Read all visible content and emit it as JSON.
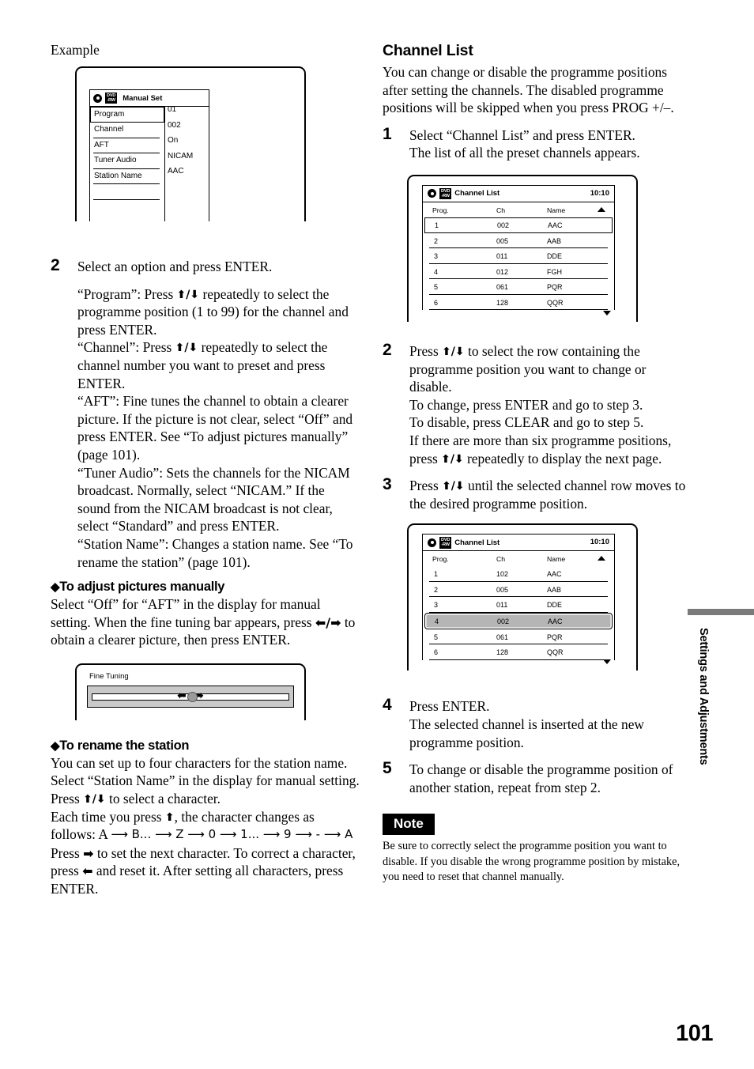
{
  "page": {
    "number": "101",
    "side_tab": "Settings and Adjustments"
  },
  "left_column": {
    "example_label": "Example",
    "manual_set_screen": {
      "icon_disc": "disc-icon",
      "icon_dvd_line1": "DVD",
      "icon_dvd_line2": "-RW",
      "title": "Manual Set",
      "rows": [
        {
          "label": "Program",
          "value": "01"
        },
        {
          "label": "Channel",
          "value": "002"
        },
        {
          "label": "AFT",
          "value": "On"
        },
        {
          "label": "Tuner Audio",
          "value": "NICAM"
        },
        {
          "label": "Station Name",
          "value": "AAC"
        }
      ]
    },
    "step2": {
      "number": "2",
      "heading": "Select an option and press ENTER.",
      "p_program_a": "“Program”: Press ",
      "p_program_b": " repeatedly to select the programme position (1 to 99) for the channel and press ENTER.",
      "p_channel_a": "“Channel”: Press ",
      "p_channel_b": " repeatedly to select the channel number you want to preset and press ENTER.",
      "p_aft": "“AFT”: Fine tunes the channel to obtain a clearer picture. If the picture is not clear, select “Off” and press ENTER. See “To adjust pictures manually” (page 101).",
      "p_tuner": "“Tuner Audio”: Sets the channels for the NICAM broadcast. Normally, select “NICAM.” If the sound from the NICAM broadcast is not clear, select “Standard” and press ENTER.",
      "p_station": "“Station Name”: Changes a station name. See “To rename the station” (page 101)."
    },
    "adjust_section": {
      "heading": "To adjust pictures manually",
      "text_a": "Select “Off” for “AFT” in the display for manual setting. When the fine tuning bar appears, press ",
      "text_b": " to obtain a clearer picture, then press ENTER."
    },
    "fine_tuning_screen": {
      "label": "Fine Tuning"
    },
    "rename_section": {
      "heading": "To rename the station",
      "p1": "You can set up to four characters for the station name. Select “Station Name” in the display for manual setting.",
      "p2_a": "Press ",
      "p2_b": " to select a character.",
      "p3_a": "Each time you press ",
      "p3_b": ", the character changes as follows: A ",
      "p3_seq": "⟶ B... ⟶ Z ⟶ 0 ⟶ 1... ⟶ 9 ⟶ - ⟶ A",
      "p4_a": "Press ",
      "p4_b": " to set the next character. To correct a character, press ",
      "p4_c": " and reset it. After setting all characters, press ENTER."
    }
  },
  "right_column": {
    "heading": "Channel List",
    "intro": "You can change or disable the programme positions after setting the channels. The disabled programme positions will be skipped when you press PROG +/–.",
    "step1": {
      "number": "1",
      "line1": "Select “Channel List” and press ENTER.",
      "line2": "The list of all the preset channels appears."
    },
    "channel_list_screen_1": {
      "icon_dvd_line1": "DVD",
      "icon_dvd_line2": "-RW",
      "title": "Channel List",
      "clock": "10:10",
      "columns": [
        "Prog.",
        "Ch",
        "Name"
      ],
      "rows": [
        {
          "prog": "1",
          "ch": "002",
          "name": "AAC",
          "state": "outline"
        },
        {
          "prog": "2",
          "ch": "005",
          "name": "AAB",
          "state": "normal"
        },
        {
          "prog": "3",
          "ch": "011",
          "name": "DDE",
          "state": "normal"
        },
        {
          "prog": "4",
          "ch": "012",
          "name": "FGH",
          "state": "normal"
        },
        {
          "prog": "5",
          "ch": "061",
          "name": "PQR",
          "state": "normal"
        },
        {
          "prog": "6",
          "ch": "128",
          "name": "QQR",
          "state": "normal"
        }
      ]
    },
    "step2": {
      "number": "2",
      "t_a": "Press ",
      "t_b": " to select the row containing the programme position you want to change or disable.",
      "t_c": "To change, press ENTER and go to step 3.",
      "t_d": "To disable, press CLEAR and go to step 5.",
      "t_e": "If there are more than six programme positions, press ",
      "t_f": " repeatedly to display the next page."
    },
    "step3": {
      "number": "3",
      "t_a": "Press ",
      "t_b": " until the selected channel row moves to the desired programme position."
    },
    "channel_list_screen_2": {
      "icon_dvd_line1": "DVD",
      "icon_dvd_line2": "-RW",
      "title": "Channel List",
      "clock": "10:10",
      "columns": [
        "Prog.",
        "Ch",
        "Name"
      ],
      "rows": [
        {
          "prog": "1",
          "ch": "102",
          "name": "AAC",
          "state": "normal"
        },
        {
          "prog": "2",
          "ch": "005",
          "name": "AAB",
          "state": "normal"
        },
        {
          "prog": "3",
          "ch": "011",
          "name": "DDE",
          "state": "normal"
        },
        {
          "prog": "4",
          "ch": "002",
          "name": "AAC",
          "state": "highlight"
        },
        {
          "prog": "5",
          "ch": "061",
          "name": "PQR",
          "state": "normal"
        },
        {
          "prog": "6",
          "ch": "128",
          "name": "QQR",
          "state": "normal"
        }
      ]
    },
    "step4": {
      "number": "4",
      "line1": "Press ENTER.",
      "line2": "The selected channel is inserted at the new programme position."
    },
    "step5": {
      "number": "5",
      "line1": "To change or disable the programme position of another station, repeat from step 2."
    },
    "note": {
      "tag": "Note",
      "body": "Be sure to correctly select the programme position you want to disable. If you disable the wrong programme position by mistake, you need to reset that channel manually."
    }
  }
}
